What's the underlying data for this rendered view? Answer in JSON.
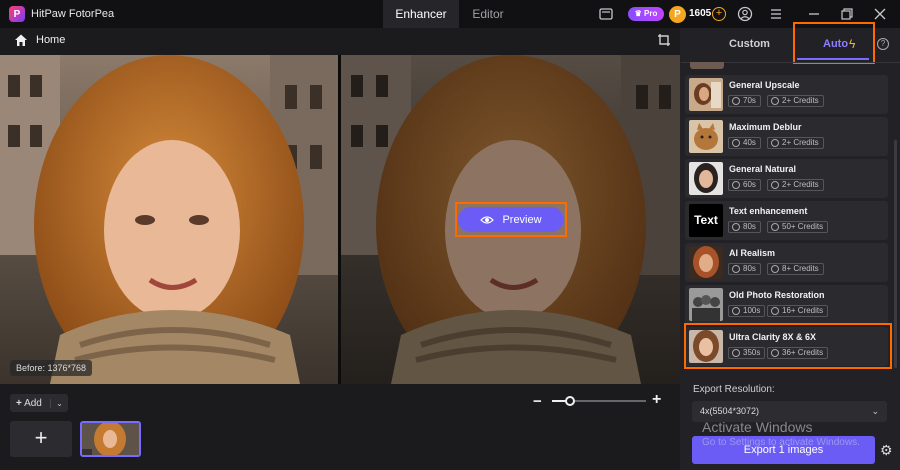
{
  "app": {
    "title": "HitPaw FotorPea",
    "logo_letter": "P"
  },
  "top_tabs": [
    {
      "label": "Enhancer",
      "active": true
    },
    {
      "label": "Editor",
      "active": false
    }
  ],
  "header": {
    "pro_label": "Pro",
    "credit_coin": "P",
    "credits": "1605",
    "add_credits": "+"
  },
  "subbar": {
    "home_label": "Home"
  },
  "canvas": {
    "before_label": "Before: 1376*768",
    "preview_label": "Preview"
  },
  "bottom": {
    "add_label": "Add",
    "add_tile": "+",
    "zoom_minus": "−",
    "zoom_plus": "+",
    "zoom_level": 0.18
  },
  "panel": {
    "tab_custom": "Custom",
    "tab_auto": "Auto",
    "models": [
      {
        "name": "General Upscale",
        "time": "70s",
        "credits": "2+ Credits"
      },
      {
        "name": "Maximum Deblur",
        "time": "40s",
        "credits": "2+ Credits"
      },
      {
        "name": "General Natural",
        "time": "60s",
        "credits": "2+ Credits"
      },
      {
        "name": "Text enhancement",
        "time": "80s",
        "credits": "50+ Credits",
        "thumb_text": "Text"
      },
      {
        "name": "AI Realism",
        "time": "80s",
        "credits": "8+ Credits"
      },
      {
        "name": "Old Photo Restoration",
        "time": "100s",
        "credits": "16+ Credits"
      },
      {
        "name": "Ultra Clarity 8X & 6X",
        "time": "350s",
        "credits": "36+ Credits"
      }
    ],
    "export_label": "Export Resolution:",
    "resolution": "4x(5504*3072)",
    "export_button": "Export 1 images"
  },
  "watermark": {
    "title": "Activate Windows",
    "subtitle": "Go to Settings to activate Windows."
  },
  "colors": {
    "accent": "#6b5cf6",
    "highlight": "#ff6a00",
    "coin": "#f4a623"
  }
}
